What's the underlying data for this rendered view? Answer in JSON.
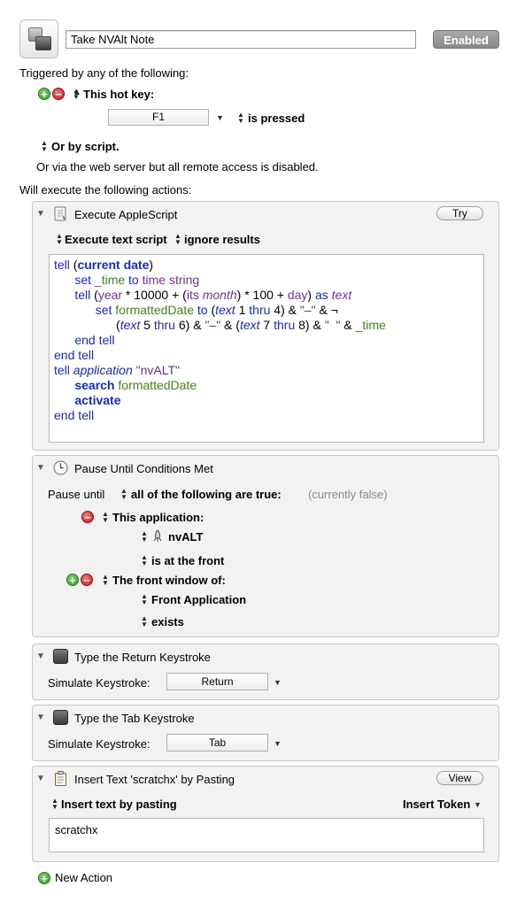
{
  "macro": {
    "name": "Take NVAlt Note",
    "enabled_label": "Enabled"
  },
  "triggers": {
    "heading": "Triggered by any of the following:",
    "hotkey_label": "This hot key:",
    "hotkey_value": "F1",
    "hotkey_mode": "is pressed",
    "script_label": "Or by script.",
    "web_note": "Or via the web server but all remote access is disabled."
  },
  "actions_heading": "Will execute the following actions:",
  "applescript": {
    "title": "Execute AppleScript",
    "try_label": "Try",
    "mode": "Execute text script",
    "results": "ignore results"
  },
  "pause": {
    "title": "Pause Until Conditions Met",
    "prefix": "Pause until",
    "condition": "all of the following are true:",
    "status": "(currently false)",
    "cond1_label": "This application:",
    "cond1_app": "nvALT",
    "cond1_state": "is at the front",
    "cond2_label": "The front window of:",
    "cond2_target": "Front Application",
    "cond2_state": "exists"
  },
  "return_action": {
    "title": "Type the Return Keystroke",
    "label": "Simulate Keystroke:",
    "value": "Return"
  },
  "tab_action": {
    "title": "Type the Tab Keystroke",
    "label": "Simulate Keystroke:",
    "value": "Tab"
  },
  "insert_action": {
    "title": "Insert Text 'scratchx' by Pasting",
    "view_label": "View",
    "mode": "Insert text by pasting",
    "token_label": "Insert Token",
    "text": "scratchx"
  },
  "new_action_label": "New Action",
  "colors": {
    "enabled_button": "#9a9a9a",
    "plus": "#2f9a1c",
    "minus": "#c8151c",
    "keyword_blue": "#1728d6",
    "property_purple": "#7b2fa8",
    "variable_green": "#3e8a16"
  },
  "icons": {
    "macro": "macro-window-icon",
    "applescript": "script-icon",
    "pause": "clock-icon",
    "keystroke": "keycap-icon",
    "insert": "clipboard-icon",
    "app": "rocket-icon"
  }
}
